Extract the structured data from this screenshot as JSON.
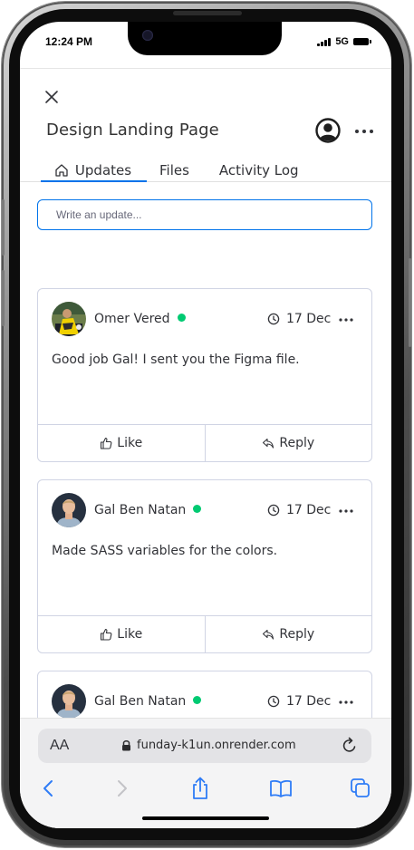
{
  "status_bar": {
    "time": "12:24 PM",
    "network": "5G"
  },
  "board": {
    "title": "Design Landing Page"
  },
  "tabs": [
    {
      "label": "Updates",
      "active": true
    },
    {
      "label": "Files",
      "active": false
    },
    {
      "label": "Activity Log",
      "active": false
    }
  ],
  "composer": {
    "placeholder": "Write an update..."
  },
  "updates": [
    {
      "author": "Omer Vered",
      "online": true,
      "date": "17 Dec",
      "text": "Good job Gal! I sent you the Figma file.",
      "like_label": "Like",
      "reply_label": "Reply"
    },
    {
      "author": "Gal Ben Natan",
      "online": true,
      "date": "17 Dec",
      "text": "Made SASS variables for the colors.",
      "like_label": "Like",
      "reply_label": "Reply"
    },
    {
      "author": "Gal Ben Natan",
      "online": true,
      "date": "17 Dec"
    }
  ],
  "browser": {
    "text_size_label": "AA",
    "url": "funday-k1un.onrender.com"
  },
  "colors": {
    "accent": "#0073ea",
    "online": "#00ca72",
    "text": "#323338",
    "safari_blue": "#2f7cf6"
  },
  "icons": [
    "close-icon",
    "user-avatar-icon",
    "more-icon",
    "home-icon",
    "clock-icon",
    "thumbs-up-icon",
    "reply-icon",
    "lock-icon",
    "reload-icon",
    "back-icon",
    "forward-icon",
    "share-icon",
    "bookmarks-icon",
    "tabs-icon"
  ]
}
